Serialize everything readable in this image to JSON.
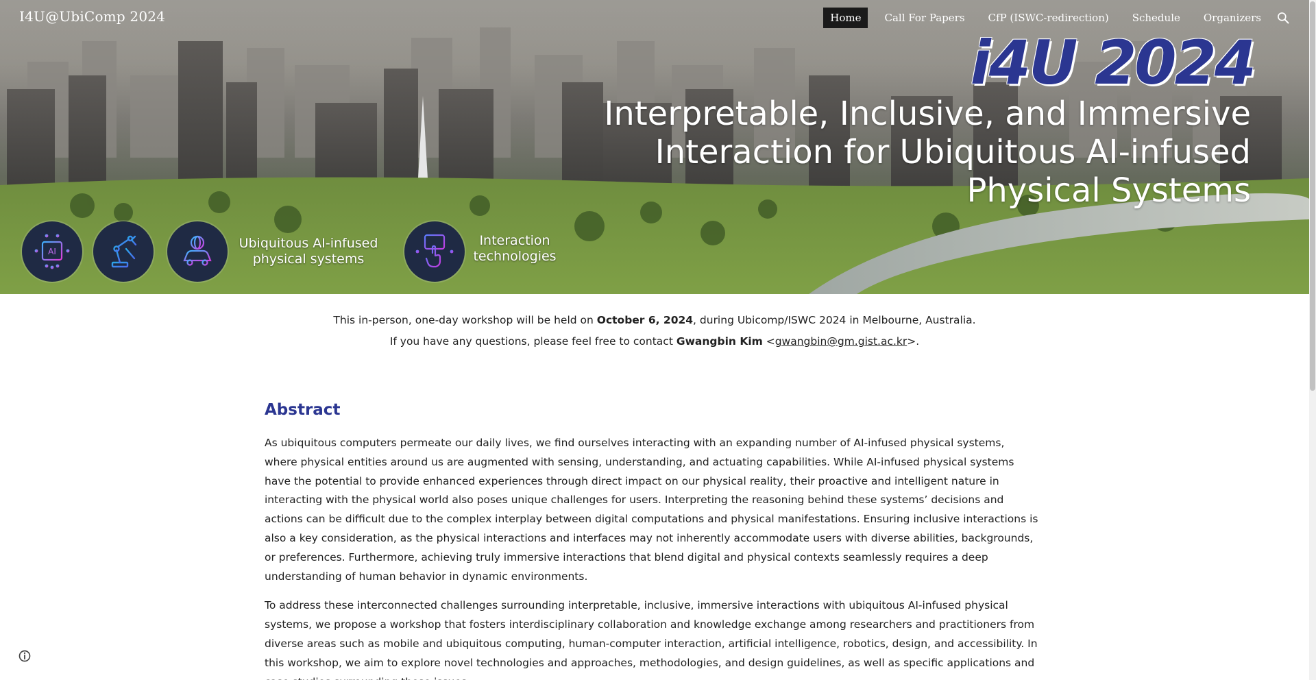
{
  "site": {
    "title": "I4U@UbiComp 2024"
  },
  "nav": {
    "items": [
      {
        "label": "Home",
        "active": true
      },
      {
        "label": "Call For Papers",
        "active": false
      },
      {
        "label": "CfP (ISWC-redirection)",
        "active": false
      },
      {
        "label": "Schedule",
        "active": false
      },
      {
        "label": "Organizers",
        "active": false
      }
    ],
    "search_icon": "search-icon"
  },
  "hero": {
    "brand": "i4U 2024",
    "headline_lines": [
      "Interpretable, Inclusive, and Immersive",
      "Interaction for Ubiquitous AI-infused",
      "Physical Systems"
    ],
    "icons": {
      "ai_chip": "ai-chip-icon",
      "robot_arm": "robot-arm-icon",
      "smart_car": "smart-car-icon",
      "touch": "touch-interaction-icon"
    },
    "topic_labels": {
      "systems": [
        "Ubiquitous AI-infused",
        "physical systems"
      ],
      "interaction": [
        "Interaction",
        "technologies"
      ]
    },
    "ai_icon_text": "AI"
  },
  "intro": {
    "line1_prefix": "This in-person, one-day workshop will be held on ",
    "line1_date": "October 6, 2024",
    "line1_suffix": ", during Ubicomp/ISWC 2024 in Melbourne, Australia.",
    "line2_prefix": "If you have any questions, please feel free to contact ",
    "contact_name": "Gwangbin Kim",
    "contact_open": " <",
    "contact_email": "gwangbin@gm.gist.ac.kr",
    "contact_close": ">."
  },
  "abstract": {
    "heading": "Abstract",
    "paragraphs": [
      "As ubiquitous computers permeate our daily lives, we find ourselves interacting with an expanding number of AI-infused physical systems, where physical entities around us are augmented with sensing, understanding, and actuating capabilities. While AI-infused physical systems have the potential to provide enhanced experiences through direct impact on our physical reality, their proactive and intelligent nature in interacting with the physical world also poses unique challenges for users. Interpreting the reasoning behind these systems’ decisions and actions can be difficult due to the complex interplay between digital computations and physical manifestations. Ensuring inclusive interactions is also a key consideration, as the physical interactions and interfaces may not inherently accommodate users with diverse abilities, backgrounds, or preferences. Furthermore, achieving truly immersive interactions that blend digital and physical contexts seamlessly requires a deep understanding of human behavior in dynamic environments.",
      "To address these interconnected challenges surrounding interpretable, inclusive, immersive interactions with ubiquitous AI-infused physical systems, we propose a workshop that fosters interdisciplinary collaboration and knowledge exchange among researchers and practitioners from diverse areas such as mobile and ubiquitous computing, human-computer interaction, artificial intelligence, robotics, design, and accessibility. In this workshop, we aim to explore novel technologies and approaches, methodologies, and design guidelines, as well as specific applications and case studies surrounding these issues."
    ]
  },
  "footer": {
    "info_icon": "info-icon"
  },
  "colors": {
    "accent": "#2b3691",
    "nav_active_bg": "#1a1a1a",
    "icon_bg": "#1f2a44"
  }
}
